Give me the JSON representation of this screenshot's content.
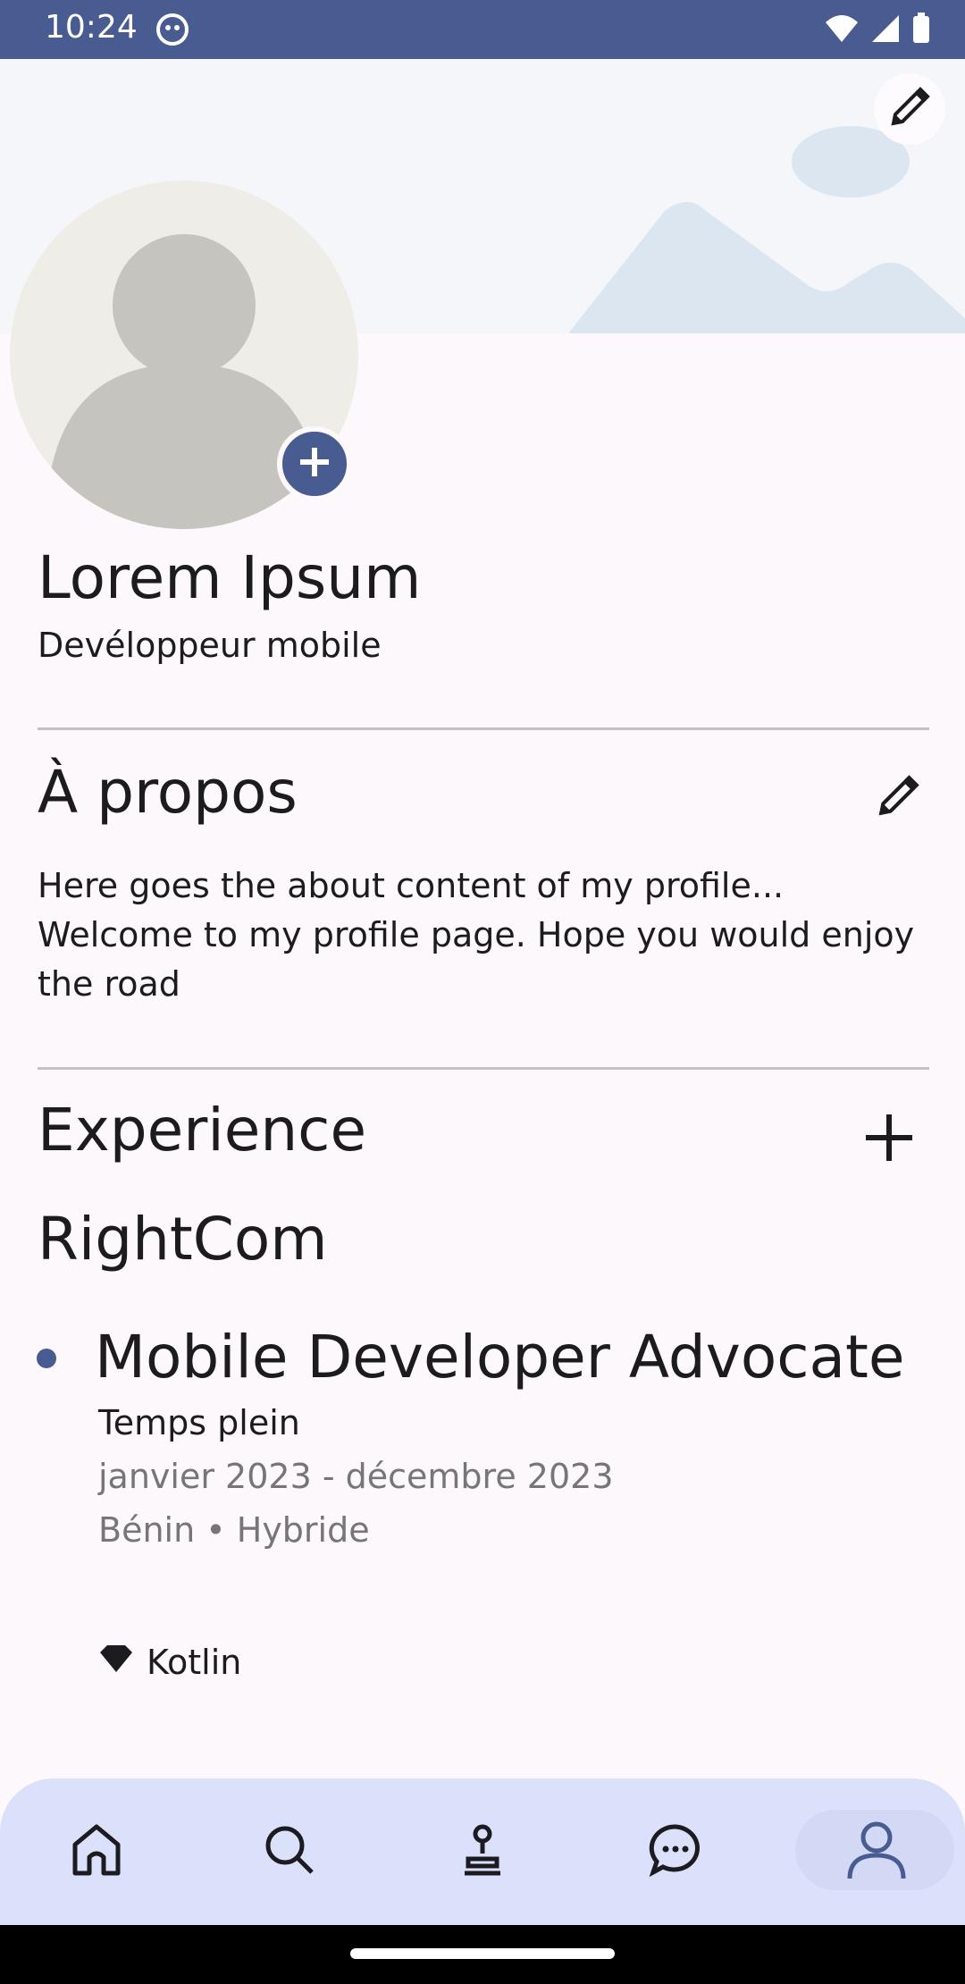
{
  "status_bar": {
    "time": "10:24"
  },
  "profile": {
    "name": "Lorem Ipsum",
    "headline": "Devéloppeur mobile"
  },
  "about": {
    "title": "À propos",
    "text": "Here goes the about content of my profile... Welcome to my profile page. Hope you would enjoy the road"
  },
  "experience": {
    "title": "Experience",
    "company": "RightCom",
    "job_title": "Mobile Developer Advocate",
    "employment_type": "Temps plein",
    "dates": "janvier 2023 - décembre 2023",
    "location": "Bénin • Hybride",
    "skill": "Kotlin"
  },
  "bottom_nav": {
    "items": [
      "home-icon",
      "search-icon",
      "jobs-icon",
      "chat-icon",
      "profile-icon"
    ],
    "active": "profile-icon"
  },
  "colors": {
    "accent": "#485c91",
    "nav_background": "#dce1fb",
    "banner": "#f4f6fa"
  }
}
